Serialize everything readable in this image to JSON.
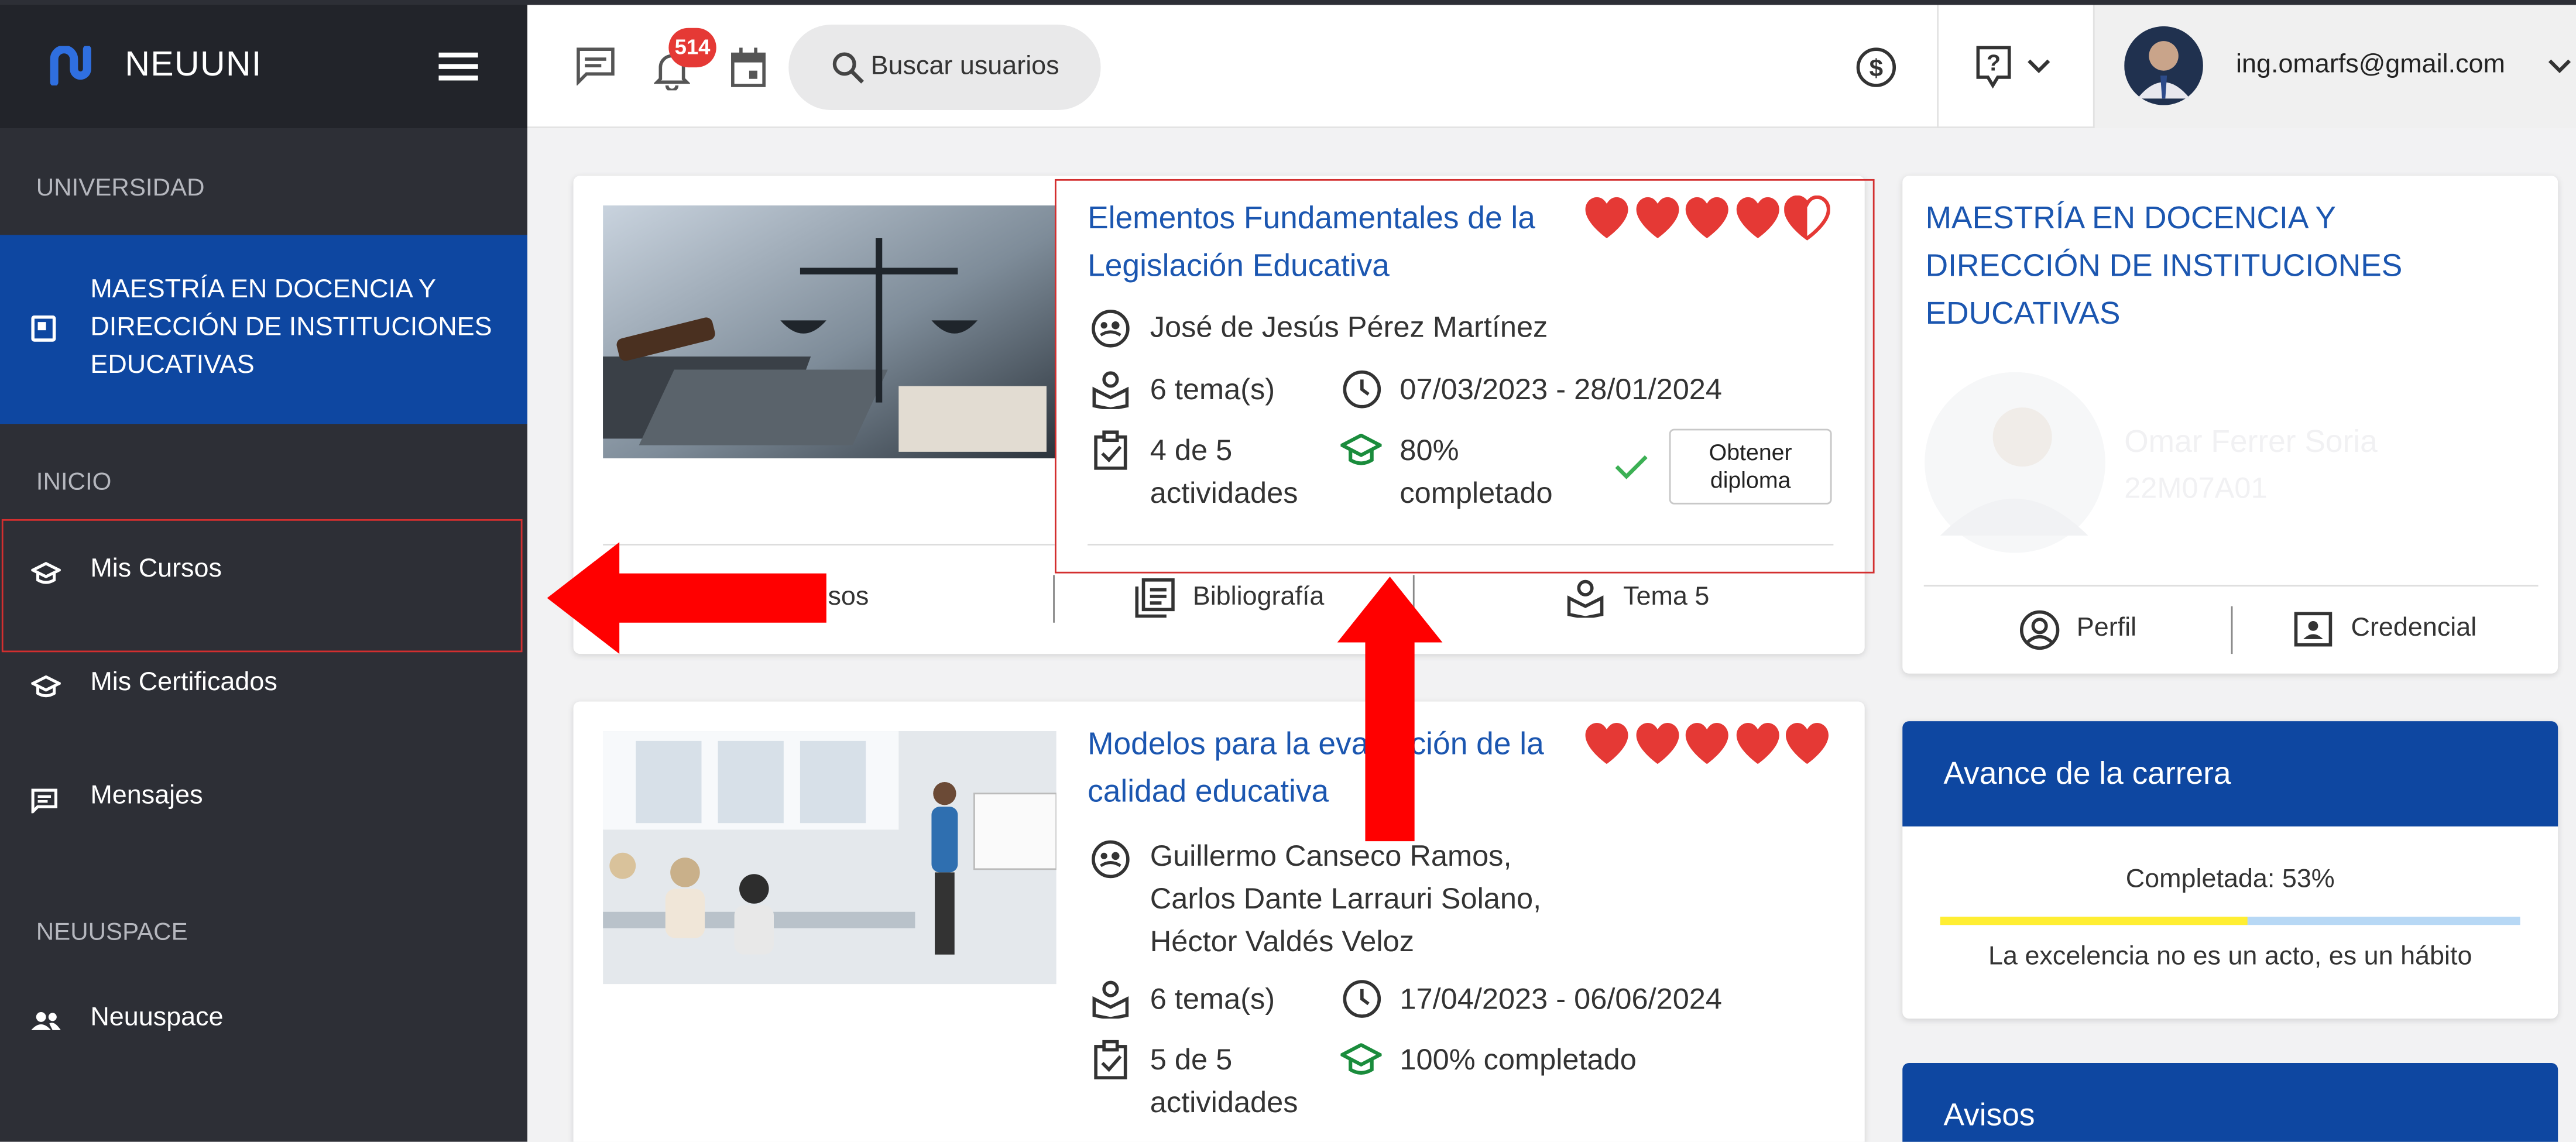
{
  "app": {
    "brand": "NEUUNI"
  },
  "sidebar": {
    "sections": {
      "universidad": "UNIVERSIDAD",
      "inicio": "INICIO",
      "neuuspace": "NEUUSPACE"
    },
    "program": "MAESTRÍA EN DOCENCIA Y DIRECCIÓN DE INSTITUCIONES EDUCATIVAS",
    "items": [
      {
        "label": "Mis Cursos",
        "icon": "mortarboard-icon"
      },
      {
        "label": "Mis Certificados",
        "icon": "mortarboard-icon"
      },
      {
        "label": "Mensajes",
        "icon": "message-icon"
      },
      {
        "label": "Neuuspace",
        "icon": "people-icon"
      }
    ]
  },
  "header": {
    "notifications_count": "514",
    "search_label": "Buscar usuarios",
    "user_email": "ing.omarfs@gmail.com"
  },
  "courses": [
    {
      "title": "Elementos Fundamentales de la Legislación Educativa",
      "instructor": "José de Jesús Pérez Martínez",
      "topics": "6 tema(s)",
      "dates": "07/03/2023 - 28/01/2024",
      "activities": "4 de 5 actividades",
      "progress": "80% completado",
      "rating": 4.5,
      "diploma_button": "Obtener diploma",
      "tabs": [
        "Avisos",
        "Bibliografía",
        "Tema 5"
      ]
    },
    {
      "title": "Modelos para la evaluación de la calidad educativa",
      "instructors": [
        "Guillermo Canseco Ramos,",
        "Carlos Dante Larrauri Solano,",
        "Héctor Valdés Veloz"
      ],
      "topics": "6 tema(s)",
      "dates": "17/04/2023 - 06/06/2024",
      "activities": "5 de 5 actividades",
      "progress": "100% completado",
      "rating": 5
    }
  ],
  "profile_card": {
    "program": "MAESTRÍA EN DOCENCIA Y DIRECCIÓN DE INSTITUCIONES EDUCATIVAS",
    "name": "Omar Ferrer Soria",
    "id": "22M07A01",
    "profile_label": "Perfil",
    "credential_label": "Credencial"
  },
  "career": {
    "title": "Avance de la carrera",
    "completed_label": "Completada: 53%",
    "progress": 0.53,
    "quote": "La excelencia no es un acto, es un hábito"
  },
  "notices": {
    "title": "Avisos"
  },
  "colors": {
    "brand": "#0e47a1",
    "heart": "#e53935",
    "success": "#2e9e44",
    "highlight": "#d32f2f",
    "progress_fill": "#ffee33",
    "progress_track": "#b7d8f5"
  }
}
